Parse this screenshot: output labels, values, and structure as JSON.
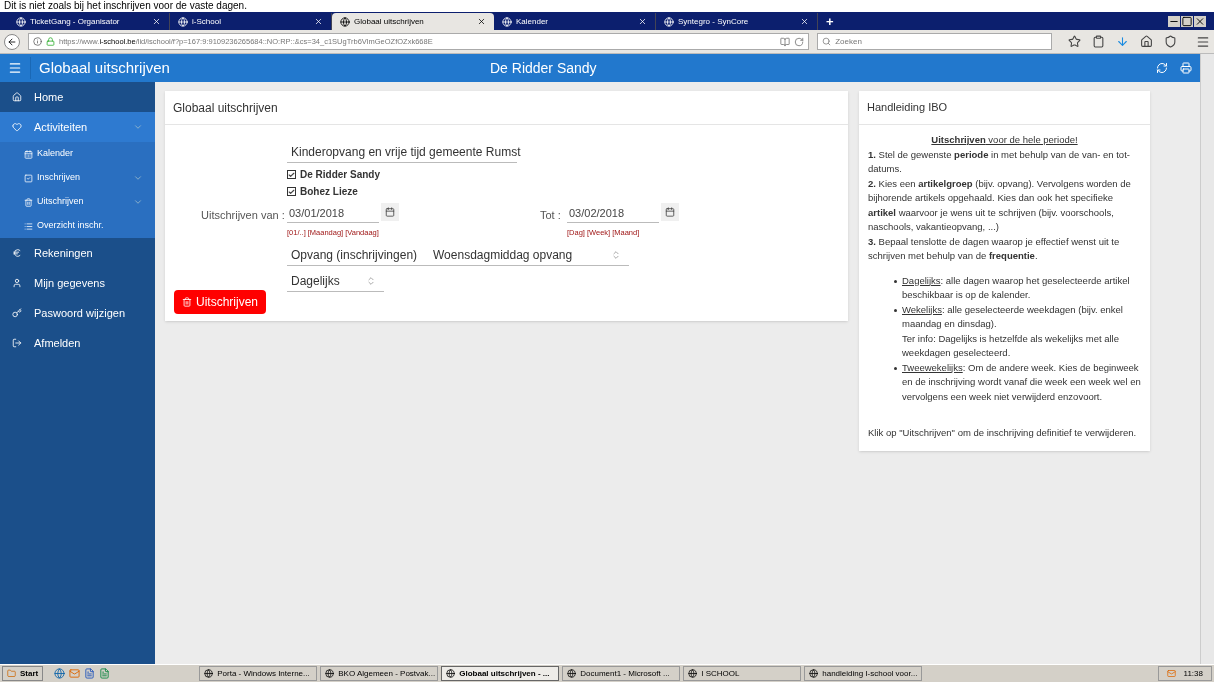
{
  "caption": "Dit is niet zoals bij het inschrijven voor de vaste dagen.",
  "browser_tabs": [
    {
      "title": "TicketGang - Organisator",
      "selected": false
    },
    {
      "title": "i-School",
      "selected": false
    },
    {
      "title": "Globaal uitschrijven",
      "selected": true
    },
    {
      "title": "Kalender",
      "selected": false
    },
    {
      "title": "Syntegro - SynCore",
      "selected": false
    }
  ],
  "new_tab": "+",
  "url": {
    "prefix": "https://www.",
    "domain": "i-school.be",
    "path": "/lid/ischool/f?p=167:9:9109236265684::NO:RP::&cs=34_c1SUgTrb6VlmGeOZfOZxk668E"
  },
  "search": {
    "placeholder": "Zoeken"
  },
  "app_header": {
    "title": "Globaal uitschrijven",
    "user": "De Ridder Sandy"
  },
  "sidebar": {
    "items": [
      {
        "label": "Home",
        "kind": "home",
        "expanded": false
      },
      {
        "label": "Activiteiten",
        "kind": "activities",
        "expanded": true,
        "children": [
          {
            "label": "Kalender",
            "kind": "calendar",
            "has_children": false
          },
          {
            "label": "Inschrijven",
            "kind": "check",
            "has_children": true
          },
          {
            "label": "Uitschrijven",
            "kind": "trash",
            "has_children": true
          },
          {
            "label": "Overzicht inschr.",
            "kind": "list",
            "has_children": false
          }
        ]
      },
      {
        "label": "Rekeningen",
        "kind": "euro",
        "expanded": false
      },
      {
        "label": "Mijn gegevens",
        "kind": "user",
        "expanded": false
      },
      {
        "label": "Paswoord wijzigen",
        "kind": "key",
        "expanded": false
      },
      {
        "label": "Afmelden",
        "kind": "logout",
        "expanded": false
      }
    ]
  },
  "form": {
    "title": "Globaal uitschrijven",
    "organisation": "Kinderopvang en vrije tijd gemeente Rumst",
    "children": [
      {
        "name": "De Ridder Sandy",
        "checked": true
      },
      {
        "name": "Bohez Lieze",
        "checked": true
      }
    ],
    "from_label": "Uitschrijven van :",
    "from_date": "03/01/2018",
    "from_links": [
      "[01/..]",
      "[Maandag]",
      "[Vandaag]"
    ],
    "to_label": "Tot :",
    "to_date": "03/02/2018",
    "to_links": [
      "[Dag]",
      "[Week]",
      "[Maand]"
    ],
    "article_group": "Opvang (inschrijvingen)",
    "article": "Woensdagmiddag opvang",
    "frequency": "Dagelijks",
    "submit": "Uitschrijven"
  },
  "help": {
    "title": "Handleiding IBO",
    "heading": "**Uitschrijven** voor de hele periode!",
    "steps": [
      "**1.** Stel de gewenste **periode** in met behulp van de van- en tot-datums.",
      "**2.** Kies een **artikelgroep** (bijv. opvang). Vervolgens worden de bijhorende artikels opgehaald. Kies dan ook het specifieke **artikel** waarvoor je wens uit te schrijven (bijv. voorschools, naschools, vakantieopvang, ...)",
      "**3.** Bepaal tenslotte de dagen waarop je effectief wenst uit te schrijven met behulp van de **frequentie**."
    ],
    "bullets": [
      {
        "term": "Dagelijks",
        "text": ": alle dagen waarop het geselecteerde artikel beschikbaar is op de kalender."
      },
      {
        "term": "Wekelijks",
        "text": ": alle geselecteerde weekdagen (bijv. enkel maandag en dinsdag).",
        "note": "Ter info: Dagelijks is hetzelfde als wekelijks met alle weekdagen geselecteerd."
      },
      {
        "term": "Tweewekelijks",
        "text": ": Om de andere week. Kies de beginweek en de inschrijving wordt vanaf die week een week wel en vervolgens een week niet verwijderd enzovoort."
      }
    ],
    "footer": "Klik op \"Uitschrijven\" om de inschrijving definitief te verwijderen."
  },
  "taskbar": {
    "start": "Start",
    "windows": [
      {
        "title": "Porta - Windows Interne...",
        "selected": false
      },
      {
        "title": "BKO Algemeen - Postvak...",
        "selected": false
      },
      {
        "title": "Globaal uitschrijven - ...",
        "selected": true
      },
      {
        "title": "Document1 - Microsoft ...",
        "selected": false
      },
      {
        "title": "I SCHOOL",
        "selected": false
      },
      {
        "title": "handleiding I-school voor...",
        "selected": false
      }
    ],
    "clock": "11:38"
  }
}
